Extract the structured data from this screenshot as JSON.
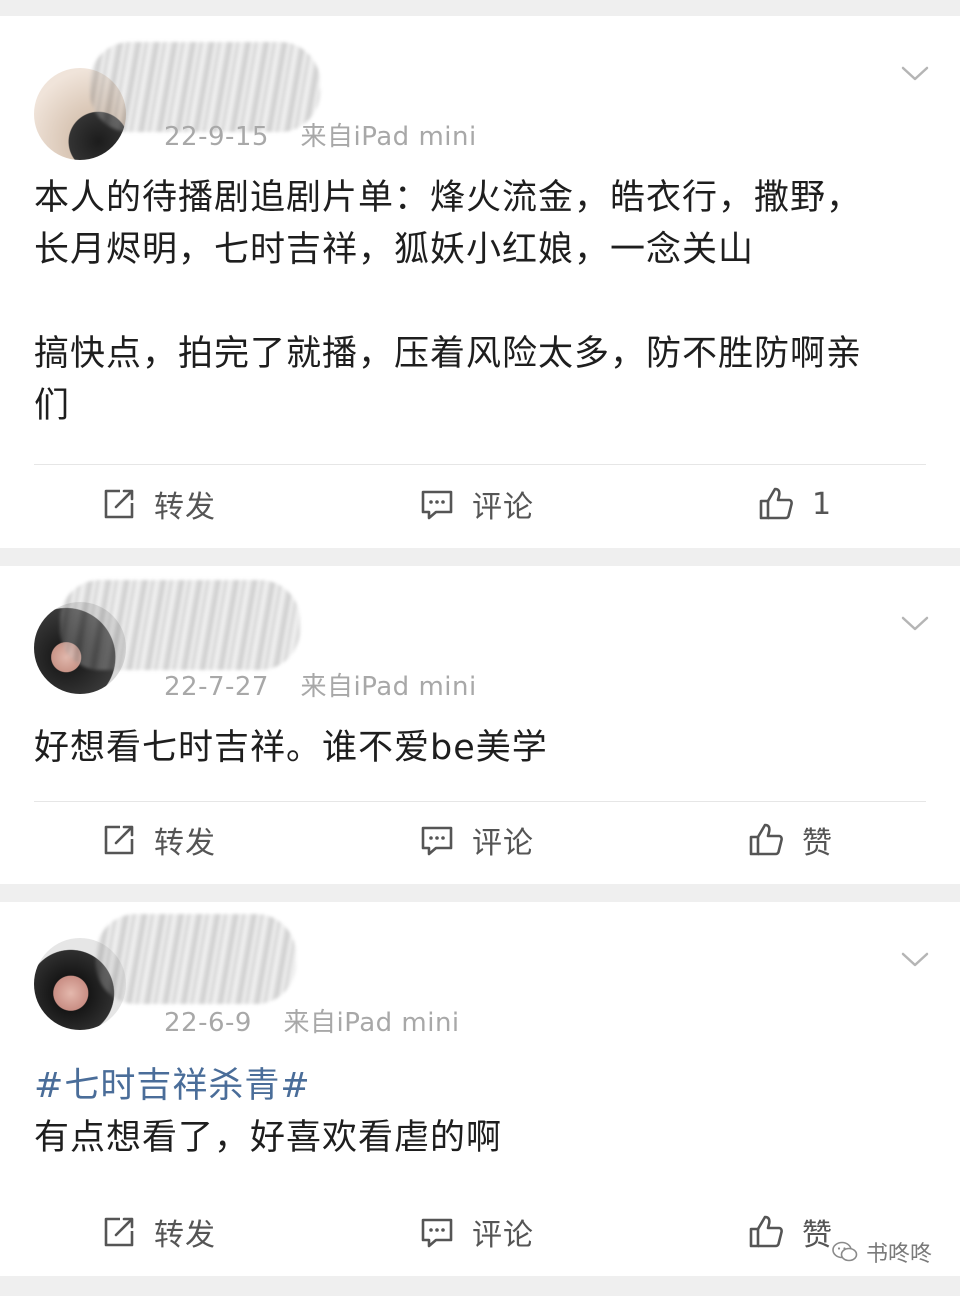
{
  "posts": [
    {
      "timestamp": "22-9-15",
      "source": "来自iPad mini",
      "text": "本人的待播剧追剧片单：烽火流金，皓衣行，撒野，\n长月烬明，七时吉祥，狐妖小红娘，一念关山\n\n搞快点，拍完了就播，压着风险太多，防不胜防啊亲\n们",
      "repost_label": "转发",
      "comment_label": "评论",
      "like_label": "1"
    },
    {
      "timestamp": "22-7-27",
      "source": "来自iPad mini",
      "text": "好想看七时吉祥。谁不爱be美学",
      "repost_label": "转发",
      "comment_label": "评论",
      "like_label": "赞"
    },
    {
      "timestamp": "22-6-9",
      "source": "来自iPad mini",
      "topic": "#七时吉祥杀青#",
      "text": "有点想看了，好喜欢看虐的啊",
      "repost_label": "转发",
      "comment_label": "评论",
      "like_label": "赞"
    }
  ],
  "watermark": {
    "label": "书咚咚"
  },
  "icons": {
    "repost": "repost-icon",
    "comment": "comment-icon",
    "like": "thumbs-up-icon",
    "more": "chevron-down-icon",
    "watermark": "wechat-icon"
  },
  "colors": {
    "background": "#efefef",
    "card": "#ffffff",
    "text": "#1e1e1e",
    "meta": "#a8a8a8",
    "topic": "#4a6d99"
  }
}
